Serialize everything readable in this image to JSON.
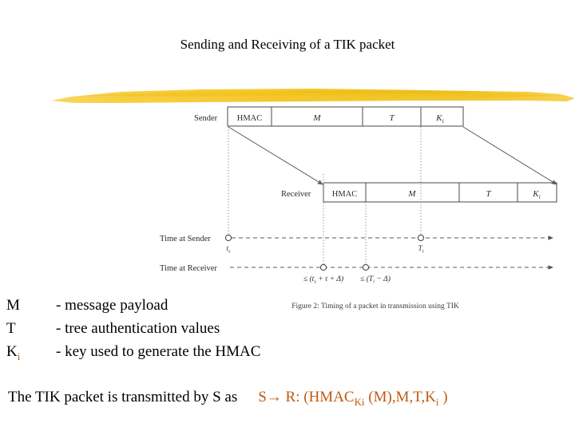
{
  "slide": {
    "title": "Sending and Receiving of a TIK packet"
  },
  "annotation": {
    "highlight_name": "yellow-highlighter-stroke",
    "highlight_color": "#f5c526"
  },
  "figure": {
    "caption": "Figure 2: Timing of a packet in transmission using TIK",
    "sender": {
      "row_label": "Sender",
      "cells": [
        "HMAC",
        "M",
        "T",
        "K",
        "i"
      ]
    },
    "receiver": {
      "row_label": "Receiver",
      "cells": [
        "HMAC",
        "M",
        "T",
        "K",
        "i"
      ]
    },
    "timelines": [
      {
        "label": "Time at Sender",
        "ticks": [
          "t",
          "s",
          "T",
          "i"
        ]
      },
      {
        "label": "Time at Receiver",
        "ticks": [
          "≤ (t",
          "s",
          " + τ + Δ)",
          "≤ (T",
          "i",
          " − Δ)"
        ]
      }
    ]
  },
  "legend": {
    "rows": [
      {
        "symbol": "M",
        "symbol_sub": "",
        "desc": "- message payload"
      },
      {
        "symbol": "T",
        "symbol_sub": "",
        "desc": "- tree authentication values"
      },
      {
        "symbol": "K",
        "symbol_sub": "i",
        "desc": "- key used to generate the HMAC"
      }
    ]
  },
  "bottom": {
    "sentence": "The TIK packet is transmitted by S as",
    "formula_prefix": "S→ R: (HMAC",
    "formula_sub1": "Ki",
    "formula_mid": " (M),M,T,K",
    "formula_sub2": "i",
    "formula_suffix": " )",
    "formula_color": "#c05a10"
  }
}
